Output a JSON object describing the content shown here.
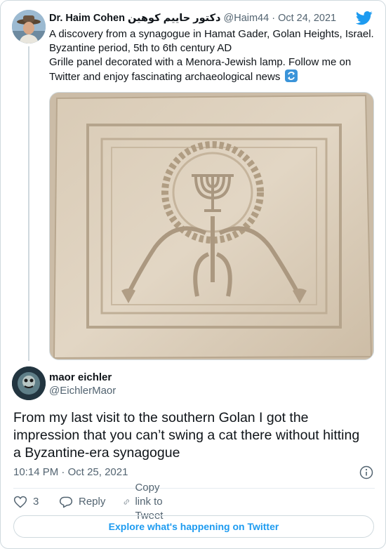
{
  "parent_tweet": {
    "author_name": "Dr. Haim Cohen",
    "author_name_arabic": "دكتور حاييم كوهين",
    "handle": "@Haim44",
    "separator": "·",
    "date": "Oct 24, 2021",
    "text_lines": [
      "A discovery from a synagogue in Hamat Gader, Golan Heights, Israel.",
      " Byzantine period, 5th to 6th century AD",
      " Grille panel decorated with a Menora-Jewish lamp. Follow me on",
      "Twitter and enjoy fascinating archaeological news"
    ],
    "trailing_emoji_icon": "counterclockwise-arrows-icon",
    "avatar_icon": "person-in-hat-avatar",
    "media_icon": "stone-menorah-panel-photo"
  },
  "reply_tweet": {
    "author_name": "maor eichler",
    "handle": "@EichlerMaor",
    "text_lines": [
      "From my last visit to the southern Golan I got the",
      "impression that you can’t swing a cat there without hitting",
      "a Byzantine-era synagogue"
    ],
    "time": "10:14 PM",
    "separator": "·",
    "date": "Oct 25, 2021"
  },
  "actions": {
    "like_count": "3",
    "reply_label": "Reply",
    "copy_link_label": "Copy link to Tweet"
  },
  "footer": {
    "explore_label": "Explore what's happening on Twitter"
  },
  "colors": {
    "accent": "#1d9bf0",
    "secondary_text": "#536471",
    "border": "#cfd9de"
  }
}
